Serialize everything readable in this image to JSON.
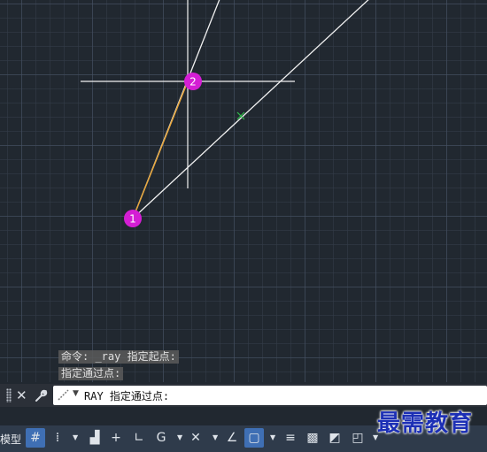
{
  "command_history": {
    "line1": "命令: _ray 指定起点:",
    "line2": "指定通过点:"
  },
  "command_line": {
    "prompt": "RAY 指定通过点:",
    "close_icon": "close-icon",
    "customize_icon": "wrench-icon",
    "recent_commands_icon": "pen-icon"
  },
  "markers": {
    "point1": "1",
    "point2": "2"
  },
  "status_bar": {
    "model_tab": "模型",
    "buttons": [
      {
        "name": "grid-icon",
        "glyph": "#",
        "on": true
      },
      {
        "name": "snap-icon",
        "glyph": "⁞",
        "on": false
      },
      {
        "name": "infer-constraints-icon",
        "glyph": "▟",
        "on": false
      },
      {
        "name": "dynamic-input-icon",
        "glyph": "+",
        "on": false
      },
      {
        "name": "ortho-icon",
        "glyph": "∟",
        "on": false
      },
      {
        "name": "polar-tracking-icon",
        "glyph": "G",
        "on": false
      },
      {
        "name": "object-snap-tracking-icon",
        "glyph": "✕",
        "on": false
      },
      {
        "name": "object-snap-icon",
        "glyph": "∠",
        "on": false
      },
      {
        "name": "2d-object-snap-icon",
        "glyph": "▢",
        "on": true
      },
      {
        "name": "lineweight-icon",
        "glyph": "≡",
        "on": false
      },
      {
        "name": "transparency-icon",
        "glyph": "▩",
        "on": false
      },
      {
        "name": "selection-cycling-icon",
        "glyph": "◩",
        "on": false
      },
      {
        "name": "3d-snap-icon",
        "glyph": "◰",
        "on": false
      }
    ]
  },
  "watermark": "最需教育",
  "colors": {
    "background": "#212830",
    "marker": "#d41ed4",
    "rubber_band": "#e8a63a",
    "lines": "#f2f2f2",
    "status_bar": "#2f3b4b",
    "active_button": "#3f6fb4"
  }
}
